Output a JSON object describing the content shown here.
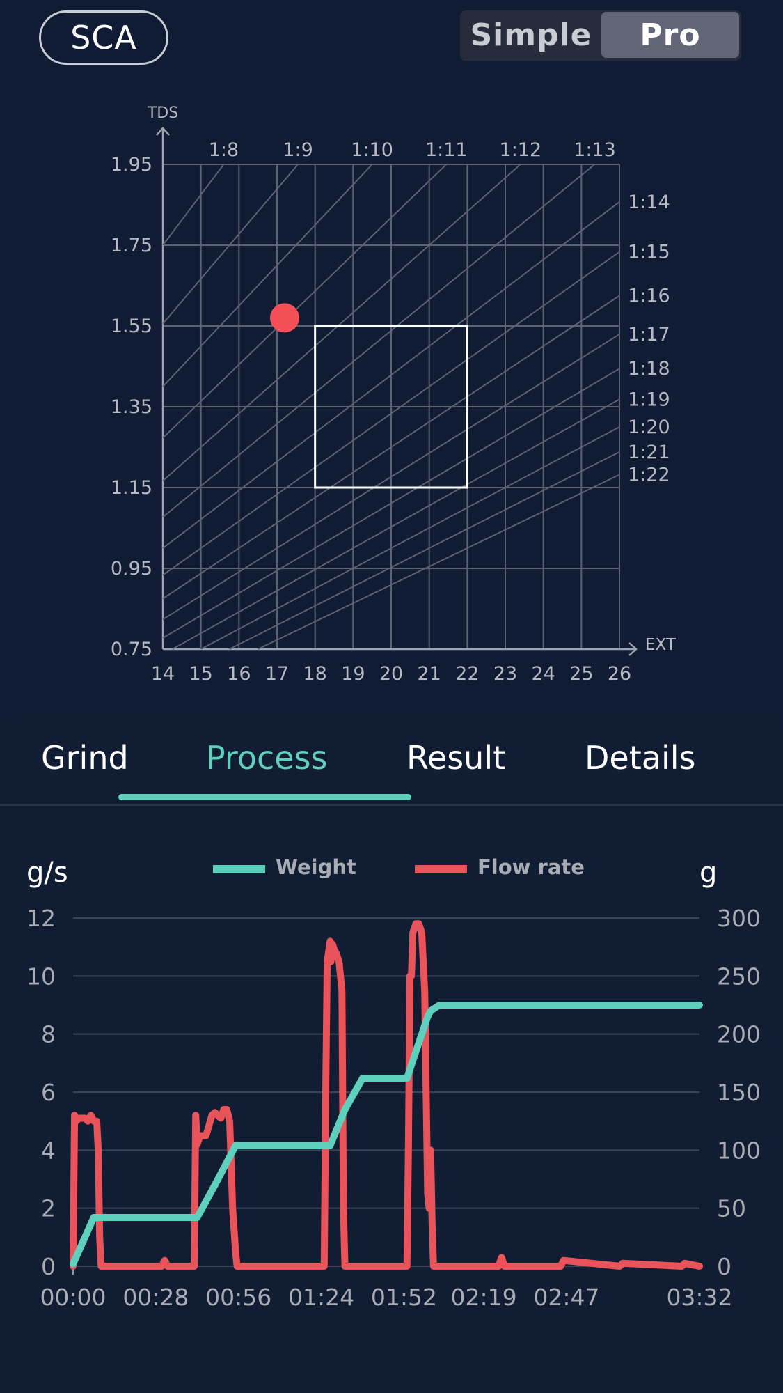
{
  "header": {
    "standard_button": "SCA",
    "mode_options": [
      "Simple",
      "Pro"
    ],
    "selected_mode": "Pro"
  },
  "brew_chart": {
    "y_axis_label": "TDS",
    "x_axis_label": "EXT",
    "y_ticks": [
      "1.95",
      "1.75",
      "1.55",
      "1.35",
      "1.15",
      "0.95",
      "0.75"
    ],
    "x_ticks": [
      "14",
      "15",
      "16",
      "17",
      "18",
      "19",
      "20",
      "21",
      "22",
      "23",
      "24",
      "25",
      "26"
    ],
    "ratio_labels": [
      "1:8",
      "1:9",
      "1:10",
      "1:11",
      "1:12",
      "1:13",
      "1:14",
      "1:15",
      "1:16",
      "1:17",
      "1:18",
      "1:19",
      "1:20",
      "1:21",
      "1:22"
    ],
    "ideal_box": {
      "ext_range": [
        18,
        22
      ],
      "tds_range": [
        1.15,
        1.55
      ]
    },
    "point": {
      "ext": 17.2,
      "tds": 1.57,
      "color": "#f55057"
    }
  },
  "tabs": {
    "items": [
      "Grind",
      "Process",
      "Result",
      "Details"
    ],
    "active": "Process"
  },
  "chart_data": {
    "type": "line",
    "left_axis_unit": "g/s",
    "right_axis_unit": "g",
    "left_ylim": [
      0,
      12
    ],
    "right_ylim": [
      0,
      300
    ],
    "left_ticks": [
      "12",
      "10",
      "8",
      "6",
      "4",
      "2",
      "0"
    ],
    "right_ticks": [
      "300",
      "250",
      "200",
      "150",
      "100",
      "50",
      "0"
    ],
    "x_ticks": [
      "00:00",
      "00:28",
      "00:56",
      "01:24",
      "01:52",
      "02:19",
      "02:47",
      "03:32"
    ],
    "series": [
      {
        "name": "Weight",
        "axis": "right",
        "color": "#5fcfbe",
        "x_seconds": [
          0,
          7,
          42,
          48,
          55,
          87,
          92,
          98,
          113,
          120,
          121,
          124,
          212
        ],
        "values": [
          2,
          42,
          42,
          70,
          104,
          104,
          135,
          162,
          162,
          215,
          220,
          225,
          225
        ]
      },
      {
        "name": "Flow rate",
        "axis": "left",
        "color": "#e9545a",
        "x_seconds": [
          0,
          0.5,
          1,
          2,
          4,
          5,
          6,
          7,
          8,
          8.5,
          9,
          9.5,
          30,
          31,
          32,
          41,
          41.5,
          42,
          43,
          44,
          45,
          47,
          48,
          50,
          51,
          52,
          53,
          54,
          55,
          55.5,
          56,
          85,
          85.5,
          86,
          87,
          87.3,
          87.8,
          88.4,
          89,
          90,
          91,
          91.5,
          92,
          113,
          113.5,
          114,
          114.5,
          115,
          116,
          117,
          118,
          119,
          120,
          120.5,
          121,
          121.5,
          122,
          122.5,
          123,
          123.5,
          124,
          144,
          145,
          146,
          165,
          166,
          185,
          186,
          206,
          207,
          212
        ],
        "values": [
          0,
          5.2,
          5.0,
          5.1,
          5.1,
          5.0,
          5.2,
          5.0,
          5.0,
          4.0,
          1.0,
          0,
          0,
          0.2,
          0,
          0,
          5.2,
          4.2,
          4.5,
          4.5,
          4.5,
          5.2,
          5.3,
          5.1,
          5.4,
          5.4,
          5.0,
          2.0,
          0.5,
          0,
          0,
          0,
          6.0,
          10.5,
          11.2,
          10.5,
          11.1,
          10.9,
          10.8,
          10.5,
          9.5,
          2.0,
          0,
          0,
          4.0,
          10.0,
          10.0,
          11.5,
          11.8,
          11.8,
          11.5,
          9.5,
          2.5,
          2.0,
          4.0,
          1.5,
          0,
          0,
          0,
          0,
          0,
          0,
          0.3,
          0,
          0,
          0.2,
          0,
          0.1,
          0,
          0.1,
          0
        ]
      }
    ],
    "xlim": [
      0,
      212
    ],
    "grid": true,
    "legend": "top"
  }
}
